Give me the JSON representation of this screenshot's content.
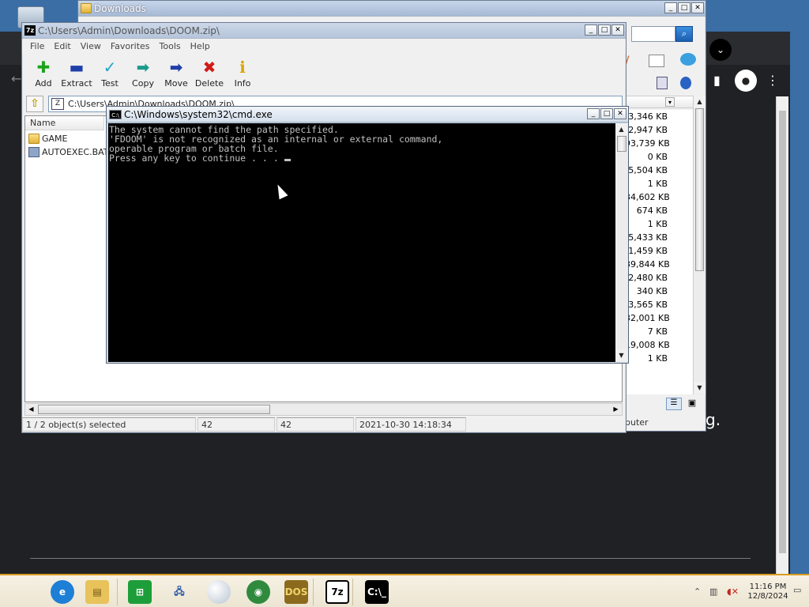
{
  "desktop": {
    "background_color": "#3a6ea5",
    "partial_text": "g."
  },
  "downloads_window": {
    "title": "Downloads",
    "file_sizes": [
      "3,346 KB",
      "2,947 KB",
      "93,739 KB",
      "0 KB",
      "5,504 KB",
      "1 KB",
      "34,602 KB",
      "674 KB",
      "1 KB",
      "5,433 KB",
      "1,459 KB",
      "39,844 KB",
      "2,480 KB",
      "340 KB",
      "3,565 KB",
      "32,001 KB",
      "7 KB",
      "19,008 KB",
      "1 KB"
    ],
    "status_text": "puter"
  },
  "sevenzip_window": {
    "title": "C:\\Users\\Admin\\Downloads\\DOOM.zip\\",
    "menu": [
      "File",
      "Edit",
      "View",
      "Favorites",
      "Tools",
      "Help"
    ],
    "toolbar": [
      {
        "label": "Add",
        "icon": "plus-icon",
        "glyph": "✚",
        "color": "#1aa31a"
      },
      {
        "label": "Extract",
        "icon": "minus-icon",
        "glyph": "▬",
        "color": "#1f3fa8"
      },
      {
        "label": "Test",
        "icon": "checkmark-icon",
        "glyph": "✓",
        "color": "#1aa8c6"
      },
      {
        "label": "Copy",
        "icon": "copy-arrow-icon",
        "glyph": "➡",
        "color": "#1a9a8c"
      },
      {
        "label": "Move",
        "icon": "move-arrow-icon",
        "glyph": "➡",
        "color": "#1f3fa8"
      },
      {
        "label": "Delete",
        "icon": "delete-x-icon",
        "glyph": "✖",
        "color": "#d11a1a"
      },
      {
        "label": "Info",
        "icon": "info-icon",
        "glyph": "ℹ",
        "color": "#d8a400"
      }
    ],
    "address": "C:\\Users\\Admin\\Downloads\\DOOM.zip\\",
    "column_name": "Name",
    "files": [
      {
        "name": "GAME",
        "type": "folder"
      },
      {
        "name": "AUTOEXEC.BAT",
        "type": "bat"
      }
    ],
    "status": {
      "selection": "1 / 2 object(s) selected",
      "size": "42",
      "packed": "42",
      "modified": "2021-10-30 14:18:34"
    }
  },
  "cmd_window": {
    "title": "C:\\Windows\\system32\\cmd.exe",
    "icon_text": "C:\\",
    "lines": [
      "The system cannot find the path specified.",
      "'FDOOM' is not recognized as an internal or external command,",
      "operable program or batch file.",
      "Press any key to continue . . . "
    ]
  },
  "taskbar": {
    "apps": [
      {
        "name": "internet-explorer-icon",
        "glyph": "e",
        "bg": "#1e7fd6",
        "fg": "#fff"
      },
      {
        "name": "file-explorer-icon",
        "glyph": "▤",
        "bg": "#e8c25a",
        "fg": "#6b5210"
      },
      {
        "name": "store-icon",
        "glyph": "⊞",
        "bg": "#1e9e3a",
        "fg": "#fff"
      },
      {
        "name": "network-computer-icon",
        "glyph": "🖧",
        "bg": "transparent",
        "fg": "#2a5aa8"
      },
      {
        "name": "globe-sphere-icon",
        "glyph": "",
        "bg": "#dfe6ef",
        "fg": "#888"
      },
      {
        "name": "chrome-browser-icon",
        "glyph": "◉",
        "bg": "#2f8a3e",
        "fg": "#fff"
      },
      {
        "name": "dosbox-icon",
        "glyph": "DOS",
        "bg": "#8b6a1e",
        "fg": "#f3d36a"
      },
      {
        "name": "sevenzip-app-icon",
        "glyph": "7z",
        "bg": "#fff",
        "fg": "#000"
      },
      {
        "name": "cmd-app-icon",
        "glyph": "C:\\_",
        "bg": "#000",
        "fg": "#fff"
      }
    ],
    "time": "11:16 PM",
    "date": "12/8/2024"
  }
}
